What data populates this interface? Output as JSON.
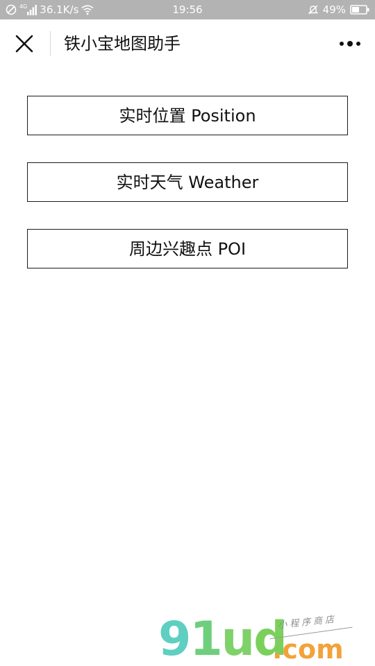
{
  "status_bar": {
    "network_speed": "36.1K/s",
    "network_type": "4G",
    "time": "19:56",
    "battery": "49%",
    "icons": [
      "dnd-icon",
      "signal-icon",
      "wifi-icon",
      "mute-icon",
      "battery-icon"
    ]
  },
  "nav": {
    "title": "铁小宝地图助手",
    "close_icon": "close-icon",
    "more_icon": "more-icon"
  },
  "menu": {
    "items": [
      {
        "label": "实时位置 Position"
      },
      {
        "label": "实时天气 Weather"
      },
      {
        "label": "周边兴趣点 POI"
      }
    ]
  },
  "watermark": {
    "digit_9": "9",
    "digit_1": "1",
    "letter_u": "u",
    "letter_d": "d",
    "domain": ".com",
    "tagline": "小程序商店"
  },
  "colors": {
    "status_bar_bg": "#b3b3b3",
    "text": "#111111",
    "border": "#1a1a1a",
    "watermark_green": "#6dcf7c",
    "watermark_orange": "#f2a23a"
  }
}
